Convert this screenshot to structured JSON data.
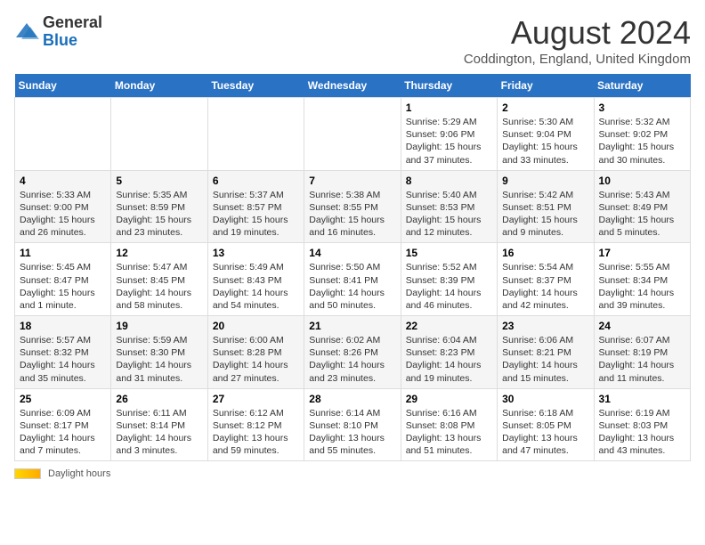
{
  "header": {
    "logo_general": "General",
    "logo_blue": "Blue",
    "month_title": "August 2024",
    "location": "Coddington, England, United Kingdom"
  },
  "footer": {
    "legend_label": "Daylight hours"
  },
  "weekdays": [
    "Sunday",
    "Monday",
    "Tuesday",
    "Wednesday",
    "Thursday",
    "Friday",
    "Saturday"
  ],
  "weeks": [
    [
      {
        "day": "",
        "info": ""
      },
      {
        "day": "",
        "info": ""
      },
      {
        "day": "",
        "info": ""
      },
      {
        "day": "",
        "info": ""
      },
      {
        "day": "1",
        "info": "Sunrise: 5:29 AM\nSunset: 9:06 PM\nDaylight: 15 hours and 37 minutes."
      },
      {
        "day": "2",
        "info": "Sunrise: 5:30 AM\nSunset: 9:04 PM\nDaylight: 15 hours and 33 minutes."
      },
      {
        "day": "3",
        "info": "Sunrise: 5:32 AM\nSunset: 9:02 PM\nDaylight: 15 hours and 30 minutes."
      }
    ],
    [
      {
        "day": "4",
        "info": "Sunrise: 5:33 AM\nSunset: 9:00 PM\nDaylight: 15 hours and 26 minutes."
      },
      {
        "day": "5",
        "info": "Sunrise: 5:35 AM\nSunset: 8:59 PM\nDaylight: 15 hours and 23 minutes."
      },
      {
        "day": "6",
        "info": "Sunrise: 5:37 AM\nSunset: 8:57 PM\nDaylight: 15 hours and 19 minutes."
      },
      {
        "day": "7",
        "info": "Sunrise: 5:38 AM\nSunset: 8:55 PM\nDaylight: 15 hours and 16 minutes."
      },
      {
        "day": "8",
        "info": "Sunrise: 5:40 AM\nSunset: 8:53 PM\nDaylight: 15 hours and 12 minutes."
      },
      {
        "day": "9",
        "info": "Sunrise: 5:42 AM\nSunset: 8:51 PM\nDaylight: 15 hours and 9 minutes."
      },
      {
        "day": "10",
        "info": "Sunrise: 5:43 AM\nSunset: 8:49 PM\nDaylight: 15 hours and 5 minutes."
      }
    ],
    [
      {
        "day": "11",
        "info": "Sunrise: 5:45 AM\nSunset: 8:47 PM\nDaylight: 15 hours and 1 minute."
      },
      {
        "day": "12",
        "info": "Sunrise: 5:47 AM\nSunset: 8:45 PM\nDaylight: 14 hours and 58 minutes."
      },
      {
        "day": "13",
        "info": "Sunrise: 5:49 AM\nSunset: 8:43 PM\nDaylight: 14 hours and 54 minutes."
      },
      {
        "day": "14",
        "info": "Sunrise: 5:50 AM\nSunset: 8:41 PM\nDaylight: 14 hours and 50 minutes."
      },
      {
        "day": "15",
        "info": "Sunrise: 5:52 AM\nSunset: 8:39 PM\nDaylight: 14 hours and 46 minutes."
      },
      {
        "day": "16",
        "info": "Sunrise: 5:54 AM\nSunset: 8:37 PM\nDaylight: 14 hours and 42 minutes."
      },
      {
        "day": "17",
        "info": "Sunrise: 5:55 AM\nSunset: 8:34 PM\nDaylight: 14 hours and 39 minutes."
      }
    ],
    [
      {
        "day": "18",
        "info": "Sunrise: 5:57 AM\nSunset: 8:32 PM\nDaylight: 14 hours and 35 minutes."
      },
      {
        "day": "19",
        "info": "Sunrise: 5:59 AM\nSunset: 8:30 PM\nDaylight: 14 hours and 31 minutes."
      },
      {
        "day": "20",
        "info": "Sunrise: 6:00 AM\nSunset: 8:28 PM\nDaylight: 14 hours and 27 minutes."
      },
      {
        "day": "21",
        "info": "Sunrise: 6:02 AM\nSunset: 8:26 PM\nDaylight: 14 hours and 23 minutes."
      },
      {
        "day": "22",
        "info": "Sunrise: 6:04 AM\nSunset: 8:23 PM\nDaylight: 14 hours and 19 minutes."
      },
      {
        "day": "23",
        "info": "Sunrise: 6:06 AM\nSunset: 8:21 PM\nDaylight: 14 hours and 15 minutes."
      },
      {
        "day": "24",
        "info": "Sunrise: 6:07 AM\nSunset: 8:19 PM\nDaylight: 14 hours and 11 minutes."
      }
    ],
    [
      {
        "day": "25",
        "info": "Sunrise: 6:09 AM\nSunset: 8:17 PM\nDaylight: 14 hours and 7 minutes."
      },
      {
        "day": "26",
        "info": "Sunrise: 6:11 AM\nSunset: 8:14 PM\nDaylight: 14 hours and 3 minutes."
      },
      {
        "day": "27",
        "info": "Sunrise: 6:12 AM\nSunset: 8:12 PM\nDaylight: 13 hours and 59 minutes."
      },
      {
        "day": "28",
        "info": "Sunrise: 6:14 AM\nSunset: 8:10 PM\nDaylight: 13 hours and 55 minutes."
      },
      {
        "day": "29",
        "info": "Sunrise: 6:16 AM\nSunset: 8:08 PM\nDaylight: 13 hours and 51 minutes."
      },
      {
        "day": "30",
        "info": "Sunrise: 6:18 AM\nSunset: 8:05 PM\nDaylight: 13 hours and 47 minutes."
      },
      {
        "day": "31",
        "info": "Sunrise: 6:19 AM\nSunset: 8:03 PM\nDaylight: 13 hours and 43 minutes."
      }
    ]
  ]
}
